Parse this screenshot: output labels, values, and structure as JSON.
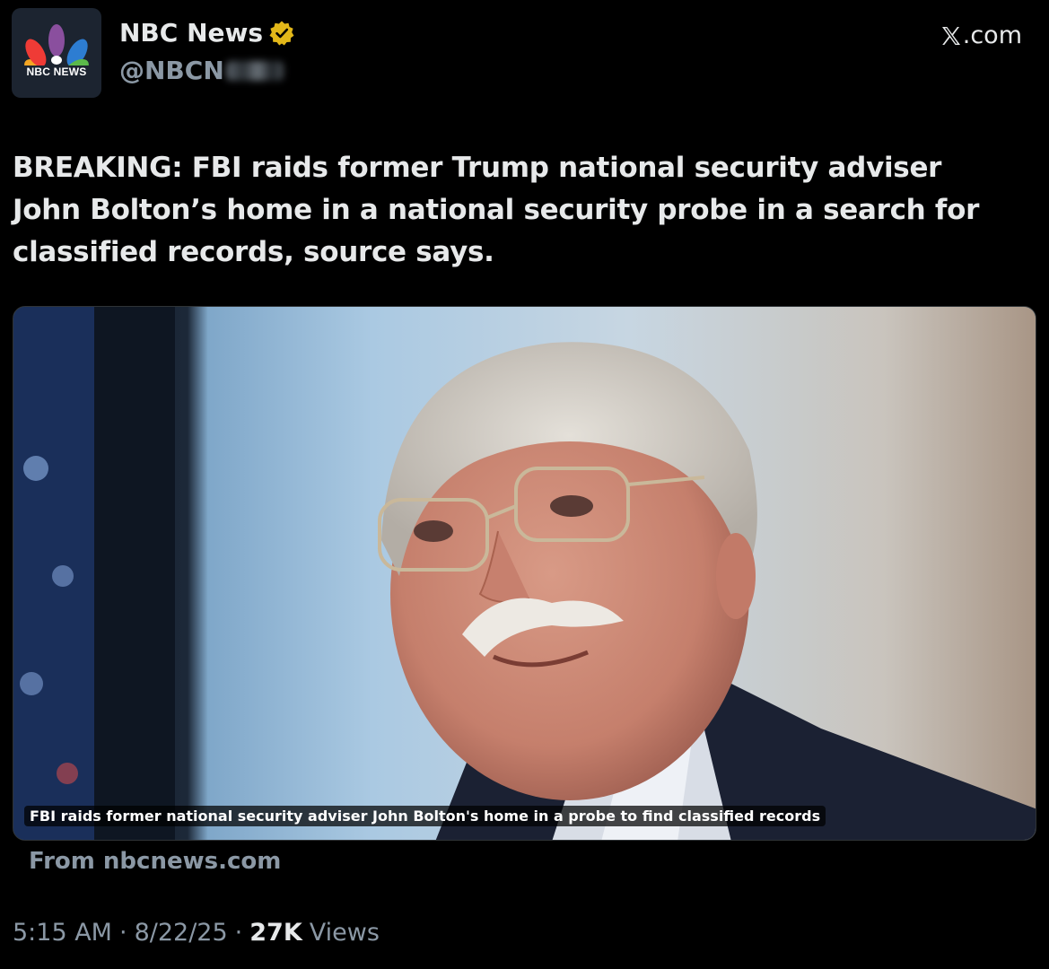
{
  "header": {
    "avatar_logo_text": "NBC NEWS",
    "display_name": "NBC News",
    "verified_badge": "gold-verified-icon",
    "handle": "@NBCN",
    "site_brand": ".com",
    "site_logo": "x-logo-icon"
  },
  "tweet": {
    "text": "BREAKING: FBI raids former Trump national security adviser John Bolton’s home in a national security probe in a search for classified records, source says."
  },
  "media": {
    "caption": "FBI raids former national security adviser John Bolton's home in a probe to find classified records",
    "source": "From nbcnews.com"
  },
  "meta": {
    "time": "5:15 AM",
    "date": "8/22/25",
    "views_count": "27K",
    "views_label": "Views",
    "separator": "·"
  },
  "colors": {
    "background": "#000000",
    "text_primary": "#e7e9ea",
    "text_secondary": "#8b98a5",
    "verified_gold": "#e2b719"
  }
}
